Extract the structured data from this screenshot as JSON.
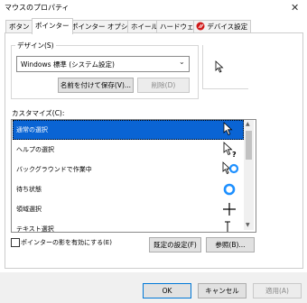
{
  "window": {
    "title": "マウスのプロパティ"
  },
  "tabs": [
    {
      "label": "ボタン"
    },
    {
      "label": "ポインター",
      "active": true
    },
    {
      "label": "ポインター オプション"
    },
    {
      "label": "ホイール"
    },
    {
      "label": "ハードウェア"
    },
    {
      "label": "デバイス設定"
    }
  ],
  "design": {
    "group_label": "デザイン(S)",
    "scheme_value": "Windows 標準 (システム設定)",
    "save_as_label": "名前を付けて保存(V)...",
    "delete_label": "削除(D)"
  },
  "customize": {
    "label": "カスタマイズ(C):",
    "items": [
      {
        "label": "通常の選択",
        "icon": "arrow-pointer-icon",
        "selected": true
      },
      {
        "label": "ヘルプの選択",
        "icon": "help-pointer-icon"
      },
      {
        "label": "バックグラウンドで作業中",
        "icon": "working-in-background-icon"
      },
      {
        "label": "待ち状態",
        "icon": "busy-ring-icon"
      },
      {
        "label": "領域選択",
        "icon": "crosshair-icon"
      },
      {
        "label": "テキスト選択",
        "icon": "text-ibeam-icon"
      }
    ]
  },
  "shadow": {
    "label": "ポインターの影を有効にする(E)",
    "checked": false
  },
  "buttons": {
    "defaults": "既定の設定(F)",
    "browse": "参照(B)...",
    "ok": "OK",
    "cancel": "キャンセル",
    "apply": "適用(A)"
  },
  "colors": {
    "selection": "#0a64d4",
    "busy_ring": "#1e90ff",
    "accent": "#0078d7"
  }
}
